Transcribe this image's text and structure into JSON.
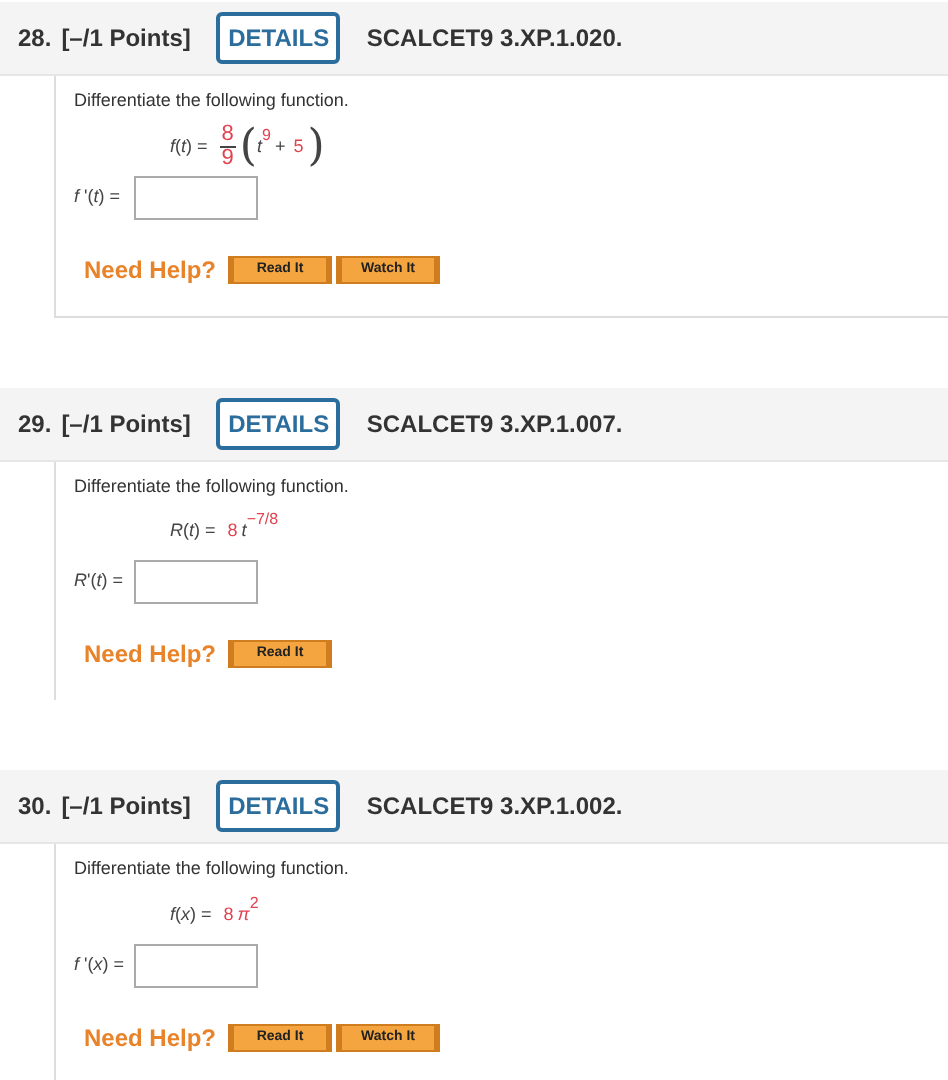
{
  "problems": [
    {
      "number": "28.",
      "points": "[–/1 Points]",
      "details": "DETAILS",
      "code": "SCALCET9 3.XP.1.020.",
      "instruction": "Differentiate the following function.",
      "lhs": "*f*(*t*) =",
      "parts": [
        {
          "kind": "fraction",
          "numerator": "8",
          "denominator": "9",
          "highlighted": true
        },
        {
          "kind": "paren",
          "text": "("
        },
        {
          "kind": "var",
          "text": "t",
          "highlighted": false
        },
        {
          "kind": "sup",
          "text": "9",
          "highlighted": true
        },
        {
          "kind": "text",
          "text": "+",
          "highlighted": false
        },
        {
          "kind": "text",
          "text": "5",
          "highlighted": true
        },
        {
          "kind": "paren",
          "text": ")"
        }
      ],
      "answer_label": "*f* '(*t*) =",
      "help_label": "Need Help?",
      "help_buttons": [
        "Read It",
        "Watch It"
      ]
    },
    {
      "number": "29.",
      "points": "[–/1 Points]",
      "details": "DETAILS",
      "code": "SCALCET9 3.XP.1.007.",
      "instruction": "Differentiate the following function.",
      "lhs": "*R*(*t*) =",
      "parts": [
        {
          "kind": "text",
          "text": "8",
          "highlighted": true
        },
        {
          "kind": "var",
          "text": "t",
          "highlighted": false
        },
        {
          "kind": "sup",
          "text": "−7/8",
          "highlighted": true
        }
      ],
      "answer_label": "*R*'(*t*) =",
      "help_label": "Need Help?",
      "help_buttons": [
        "Read It"
      ]
    },
    {
      "number": "30.",
      "points": "[–/1 Points]",
      "details": "DETAILS",
      "code": "SCALCET9 3.XP.1.002.",
      "instruction": "Differentiate the following function.",
      "lhs": "*f*(*x*) =",
      "parts": [
        {
          "kind": "text",
          "text": "8",
          "highlighted": true
        },
        {
          "kind": "var",
          "text": "π",
          "highlighted": true
        },
        {
          "kind": "sup",
          "text": "2",
          "highlighted": true
        }
      ],
      "answer_label": "*f* '(*x*) =",
      "help_label": "Need Help?",
      "help_buttons": [
        "Read It",
        "Watch It"
      ]
    }
  ]
}
